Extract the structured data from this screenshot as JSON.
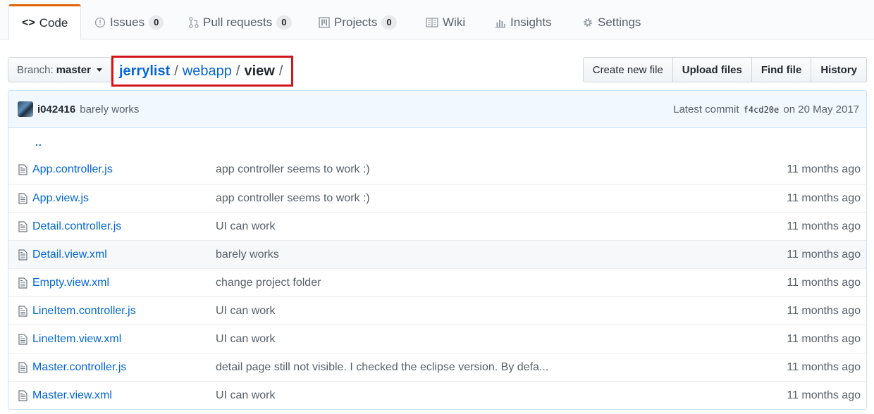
{
  "tabs": [
    {
      "label": "Code",
      "icon": "code-icon",
      "selected": true
    },
    {
      "label": "Issues",
      "icon": "issue-icon",
      "count": "0"
    },
    {
      "label": "Pull requests",
      "icon": "pull-request-icon",
      "count": "0"
    },
    {
      "label": "Projects",
      "icon": "project-icon",
      "count": "0"
    },
    {
      "label": "Wiki",
      "icon": "book-icon"
    },
    {
      "label": "Insights",
      "icon": "graph-icon"
    },
    {
      "label": "Settings",
      "icon": "gear-icon"
    }
  ],
  "branch": {
    "label": "Branch:",
    "value": "master"
  },
  "breadcrumb": {
    "repo": "jerrylist",
    "sep": "/",
    "folder": "webapp",
    "current": "view"
  },
  "actions": {
    "create": "Create new file",
    "upload": "Upload files",
    "find": "Find file",
    "history": "History"
  },
  "commit": {
    "author": "i042416",
    "message": "barely works",
    "prefix": "Latest commit",
    "sha": "f4cd20e",
    "date": "on 20 May 2017"
  },
  "parent_link": "..",
  "files": [
    {
      "name": "App.controller.js",
      "message": "app controller seems to work :)",
      "age": "11 months ago"
    },
    {
      "name": "App.view.js",
      "message": "app controller seems to work :)",
      "age": "11 months ago"
    },
    {
      "name": "Detail.controller.js",
      "message": "UI can work",
      "age": "11 months ago"
    },
    {
      "name": "Detail.view.xml",
      "message": "barely works",
      "age": "11 months ago"
    },
    {
      "name": "Empty.view.xml",
      "message": "change project folder",
      "age": "11 months ago"
    },
    {
      "name": "LineItem.controller.js",
      "message": "UI can work",
      "age": "11 months ago"
    },
    {
      "name": "LineItem.view.xml",
      "message": "UI can work",
      "age": "11 months ago"
    },
    {
      "name": "Master.controller.js",
      "message": "detail page still not visible. I checked the eclipse version. By defa...",
      "age": "11 months ago"
    },
    {
      "name": "Master.view.xml",
      "message": "UI can work",
      "age": "11 months ago"
    }
  ],
  "colors": {
    "link": "#0366d6",
    "accent": "#e36209",
    "highlight_box": "#d0161c"
  }
}
